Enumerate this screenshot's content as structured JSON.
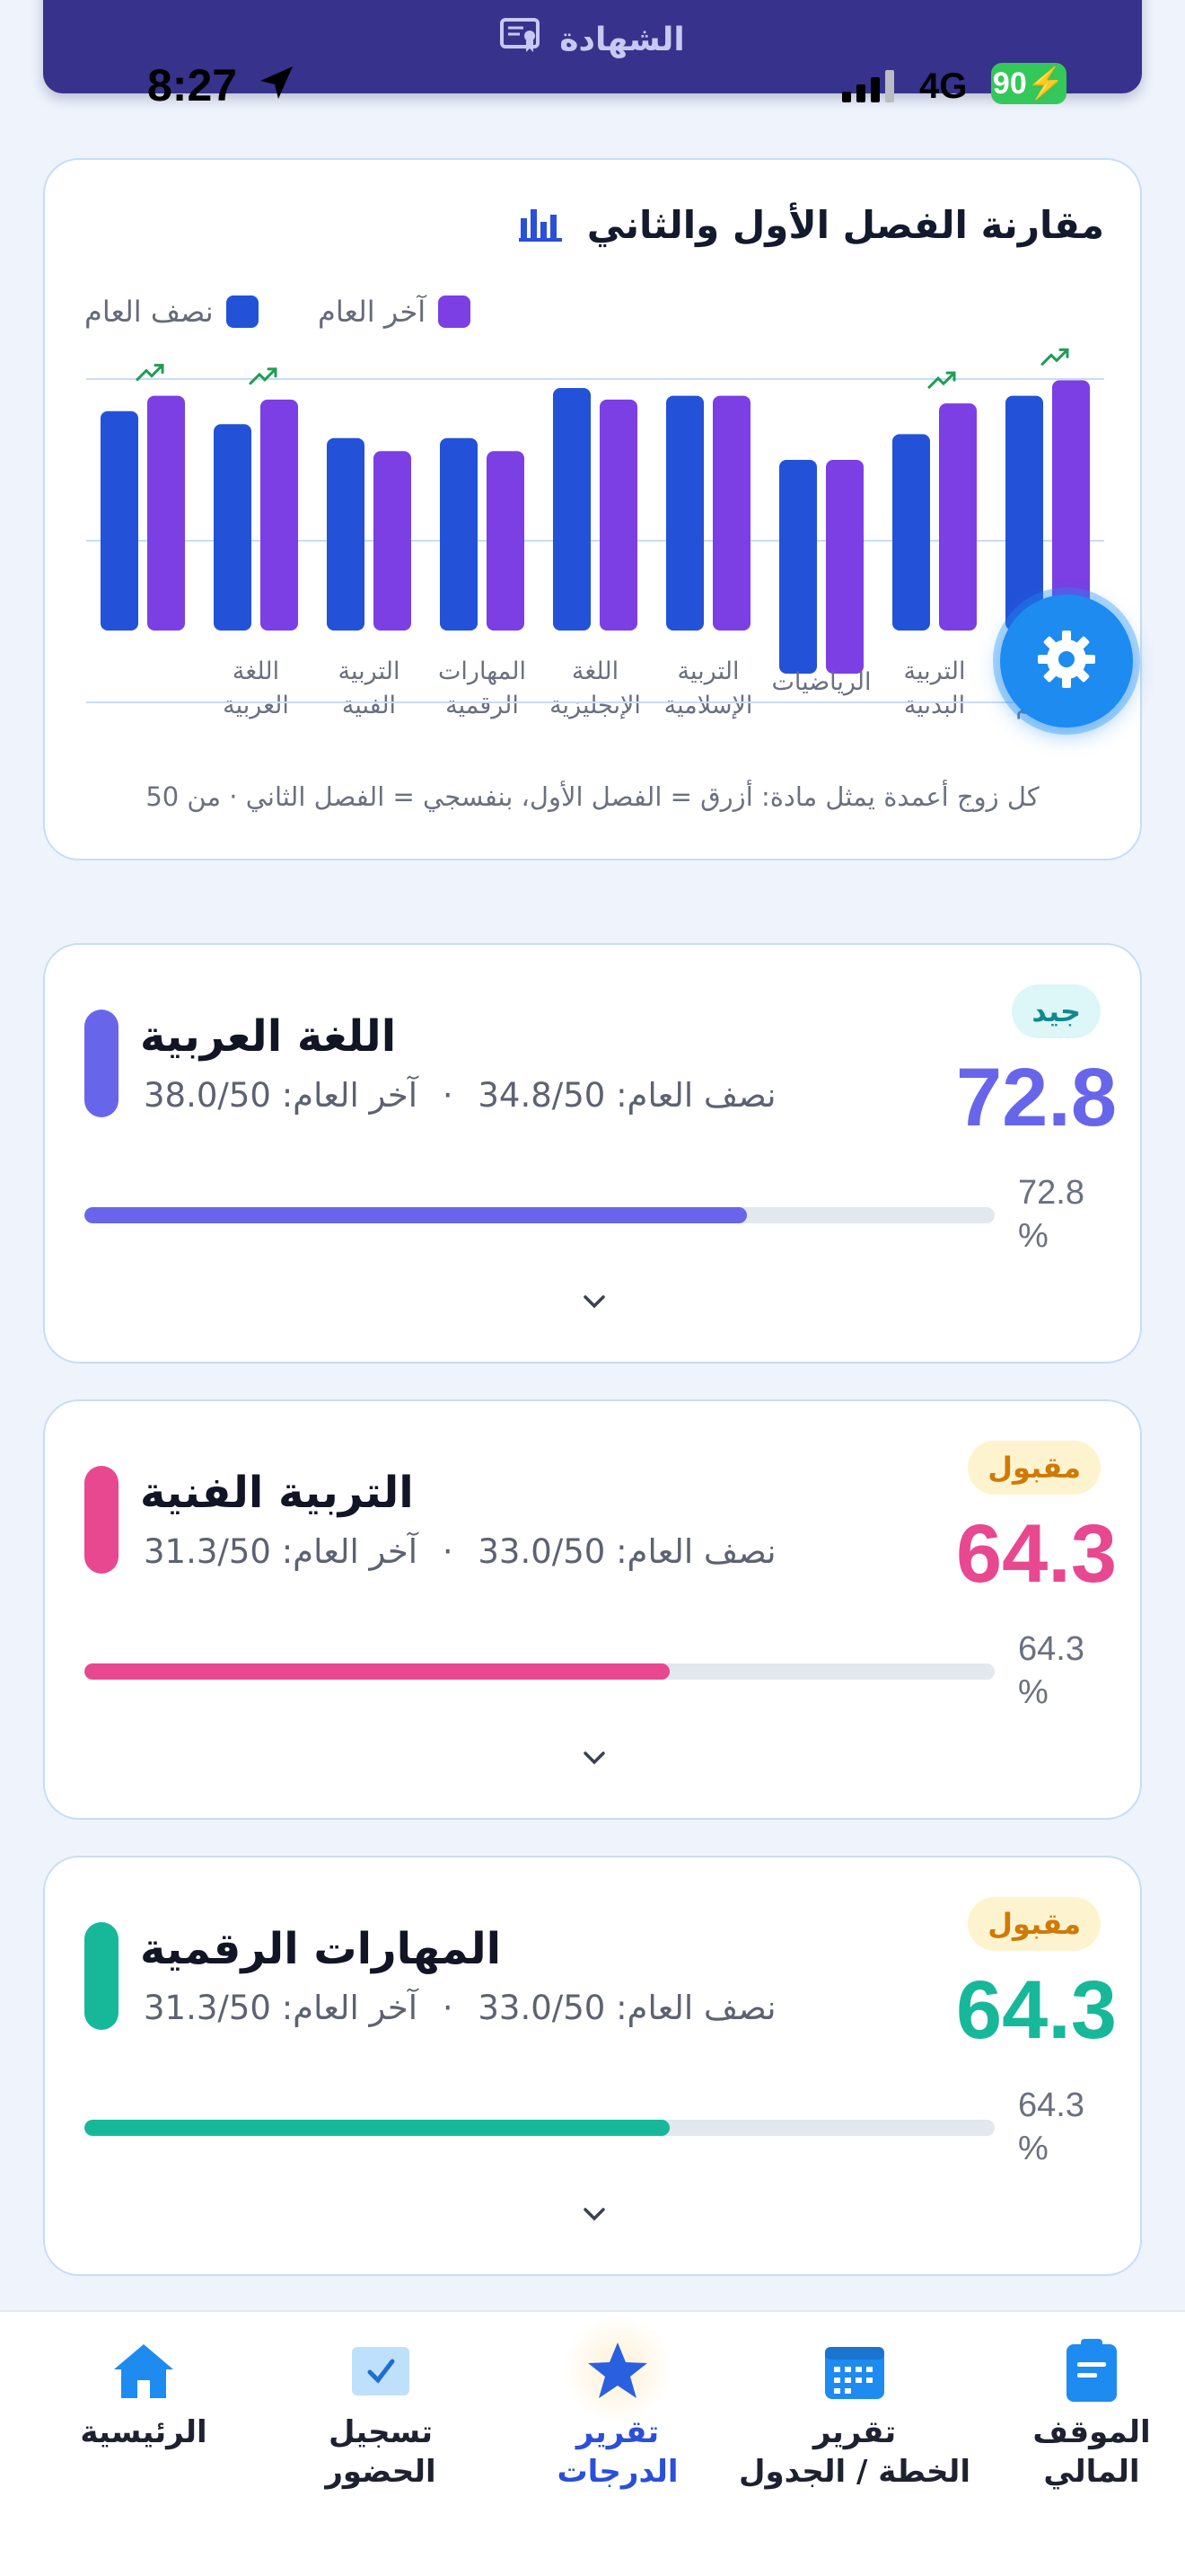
{
  "top_pill": {
    "label": "الشهادة"
  },
  "status_bar": {
    "time": "8:27",
    "network": "4G",
    "battery": "90"
  },
  "chart_card": {
    "title": "مقارنة الفصل الأول والثاني",
    "caption": "كل زوج أعمدة يمثل مادة: أزرق = الفصل الأول، بنفسجي = الفصل الثاني · من 50"
  },
  "chart_data": {
    "type": "bar",
    "categories": [
      "القرآن الكريم",
      "التربية البدنية",
      "الرياضيات",
      "التربية الإسلامية",
      "اللغة الإنجليزية",
      "المهارات الرقمية",
      "التربية الفنية",
      "اللغة العربية",
      ""
    ],
    "category_lines": [
      [
        "القرآن",
        "الكريم"
      ],
      [
        "التربية",
        "البدنية"
      ],
      [
        "الرياضيات"
      ],
      [
        "التربية",
        "الإسلامية"
      ],
      [
        "اللغة",
        "الإنجليزية"
      ],
      [
        "المهارات",
        "الرقمية"
      ],
      [
        "التربية",
        "الفنية"
      ],
      [
        "اللغة",
        "العربية"
      ],
      []
    ],
    "series": [
      {
        "name": "نصف العام",
        "color": "#2352d8",
        "values": [
          38.5,
          33.5,
          27.0,
          38.5,
          39.5,
          33.0,
          33.0,
          34.8,
          36.5
        ]
      },
      {
        "name": "آخر العام",
        "color": "#7b3fe4",
        "values": [
          40.5,
          37.5,
          27.0,
          38.5,
          38.0,
          31.3,
          31.3,
          38.0,
          38.5
        ]
      }
    ],
    "trend_up": [
      true,
      true,
      false,
      false,
      false,
      false,
      false,
      true,
      true
    ],
    "ylim": [
      0,
      50
    ],
    "grid": true,
    "legend_position": "top-left"
  },
  "subjects": [
    {
      "name": "اللغة العربية",
      "mid_label": "نصف العام:",
      "mid_value": "34.8/50",
      "final_label": "آخر العام:",
      "final_value": "38.0/50",
      "badge": "جيد",
      "badge_color": "#12898c",
      "badge_bg": "#ddf6f7",
      "score": "72.8",
      "percent": 72.8,
      "percent_label": "72.8 %",
      "color": "#6766ea"
    },
    {
      "name": "التربية الفنية",
      "mid_label": "نصف العام:",
      "mid_value": "33.0/50",
      "final_label": "آخر العام:",
      "final_value": "31.3/50",
      "badge": "مقبول",
      "badge_color": "#cf7a08",
      "badge_bg": "#fdf3cf",
      "score": "64.3",
      "percent": 64.3,
      "percent_label": "64.3 %",
      "color": "#e8488f"
    },
    {
      "name": "المهارات الرقمية",
      "mid_label": "نصف العام:",
      "mid_value": "33.0/50",
      "final_label": "آخر العام:",
      "final_value": "31.3/50",
      "badge": "مقبول",
      "badge_color": "#cf7a08",
      "badge_bg": "#fdf3cf",
      "score": "64.3",
      "percent": 64.3,
      "percent_label": "64.3 %",
      "color": "#17b89a"
    }
  ],
  "bottom_nav": [
    {
      "label": "الموقف\nالمالي",
      "icon": "clipboard-icon"
    },
    {
      "label": "تقرير\nالخطة / الجدول",
      "icon": "calendar-icon"
    },
    {
      "label": "تقرير\nالدرجات",
      "icon": "star-icon",
      "active": true
    },
    {
      "label": "تسجيل\nالحضور",
      "icon": "checkbox-icon"
    },
    {
      "label": "الرئيسية",
      "icon": "home-icon"
    }
  ],
  "colors": {
    "accent": "#2a4fd8",
    "background": "#eef3fc",
    "card_border": "#c8dcf6"
  }
}
